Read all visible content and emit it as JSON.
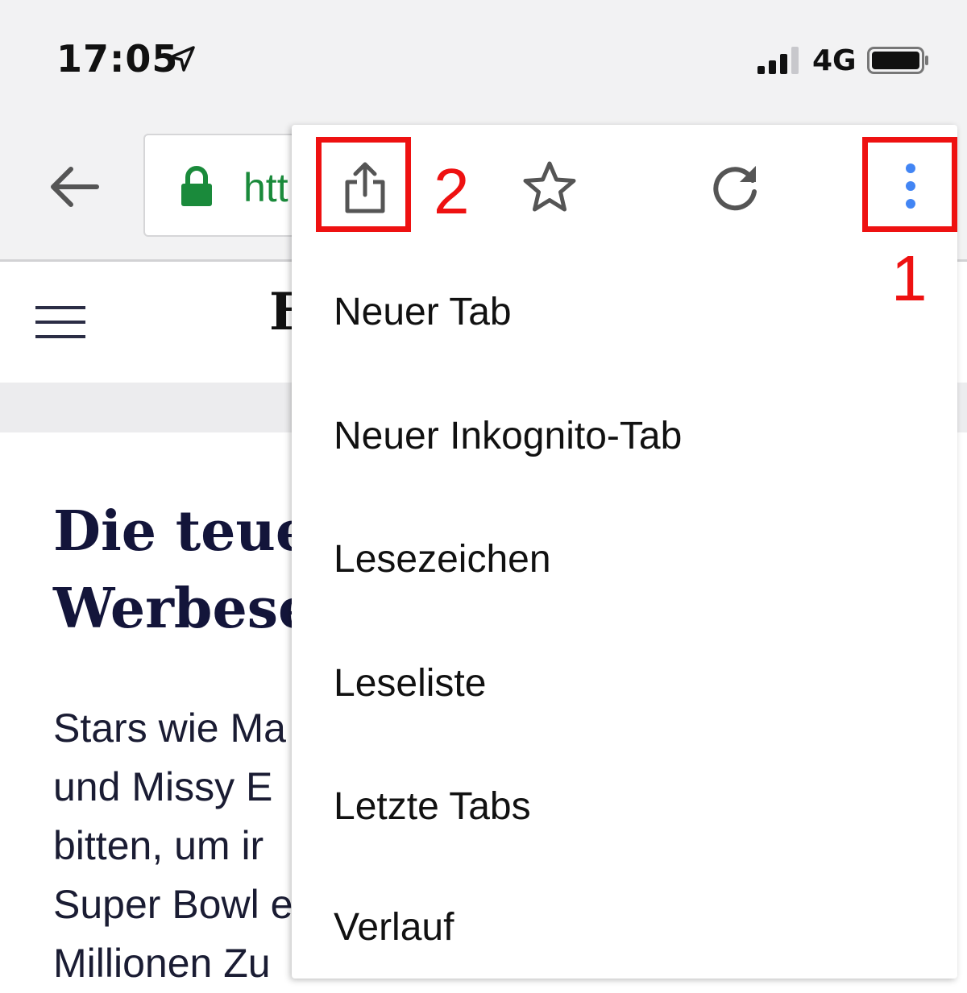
{
  "status_bar": {
    "time": "17:05",
    "network": "4G"
  },
  "browser_toolbar": {
    "url_partial": "htt"
  },
  "site": {
    "logo_partial": "F"
  },
  "article": {
    "title": "Die teue\nWerbese",
    "body": "Stars wie Ma\nund Missy E\nbitten, um ir\nSuper Bowl e\nMillionen Zu"
  },
  "menu": {
    "items": [
      {
        "label": "Neuer Tab"
      },
      {
        "label": "Neuer Inkognito-Tab"
      },
      {
        "label": "Lesezeichen"
      },
      {
        "label": "Leseliste"
      },
      {
        "label": "Letzte Tabs"
      },
      {
        "label": "Verlauf"
      }
    ]
  },
  "annotations": {
    "step_1": "1",
    "step_2": "2"
  },
  "colors": {
    "highlight": "#ee1111",
    "accent_blue": "#4285f4",
    "secure_green": "#1a8a3b"
  },
  "icons": [
    "location-arrow-icon",
    "cellular-signal-icon",
    "battery-icon",
    "back-arrow-icon",
    "lock-icon",
    "hamburger-icon",
    "share-icon",
    "star-icon",
    "reload-icon",
    "more-vertical-icon"
  ]
}
